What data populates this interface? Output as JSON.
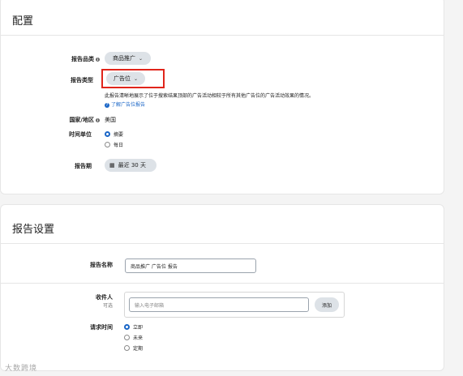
{
  "config": {
    "title": "配置",
    "report_category": {
      "label": "报告品类",
      "value": "商品推广"
    },
    "report_type": {
      "label": "报告类型",
      "value": "广告位",
      "description": "此报告清晰地展示了位于搜索结果顶部的广告活动相较于所有其他广告位的广告活动效果的情况。",
      "learn_more": "了解广告位报告"
    },
    "country": {
      "label": "国家/地区",
      "value": "美国"
    },
    "time_unit": {
      "label": "时间单位",
      "options": [
        "摘要",
        "每日"
      ],
      "selected": 0
    },
    "period": {
      "label": "报告期",
      "value": "最近 30 天"
    }
  },
  "settings": {
    "title": "报告设置",
    "report_name": {
      "label": "报告名称",
      "value": "商品推广 广告位 报告"
    },
    "recipients": {
      "label": "收件人",
      "optional": "可选",
      "placeholder": "输入电子邮箱",
      "add_label": "添加"
    },
    "request_time": {
      "label": "请求时间",
      "options": [
        "立即",
        "未来",
        "定期"
      ],
      "selected": 0
    }
  },
  "colors": {
    "accent": "#1a66c7",
    "highlight": "#e0251b",
    "pill": "#dde2e7"
  },
  "watermark": "大数跨境"
}
